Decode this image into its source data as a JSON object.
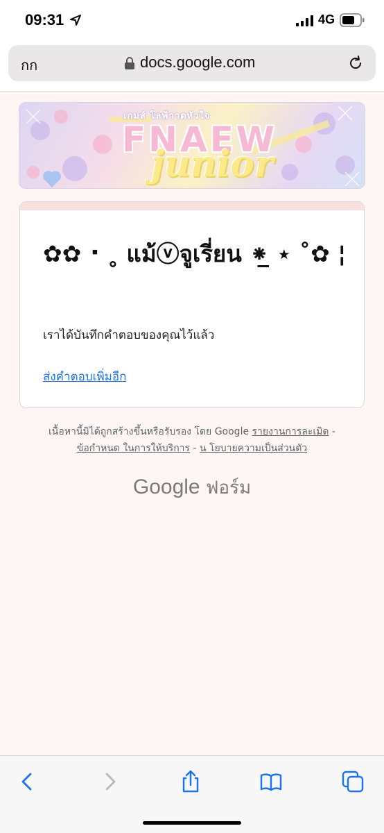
{
  "status_bar": {
    "time": "09:31",
    "network": "4G"
  },
  "browser": {
    "text_size_button": "กก",
    "url": "docs.google.com"
  },
  "banner": {
    "small_text": "เกมส์ โลฟ้าาดหัวใจ",
    "big_text": "FNAEW",
    "script_text": "junior"
  },
  "card": {
    "title": "✿✿ ⠂˳ แม้ⓥจูเรี่ยน ⁕̲ ⋆ ˚✿ ¦",
    "message": "เราได้บันทึกคำตอบของคุณไว้แล้ว",
    "resubmit_link": "ส่งคำตอบเพิ่มอีก"
  },
  "footer": {
    "disclaimer": "เนื้อหานี้มิได้ถูกสร้างขึ้นหรือรับรอง โดย Google",
    "report_link": "รายงานการละเมิด",
    "separator": "-",
    "terms_link": "ข้อกำหนด ในการให้บริการ",
    "privacy_link": "น โยบายความเป็นส่วนตัว",
    "brand_google": "Google",
    "brand_forms": "ฟอร์ม"
  },
  "toolbar": {
    "back": "chevron-left-icon",
    "forward": "chevron-right-icon",
    "share": "share-icon",
    "bookmarks": "book-icon",
    "tabs": "tabs-icon"
  },
  "colors": {
    "link": "#1a73e8",
    "card_accent": "#f8e0dc",
    "page_bg": "#fdf6f5"
  }
}
